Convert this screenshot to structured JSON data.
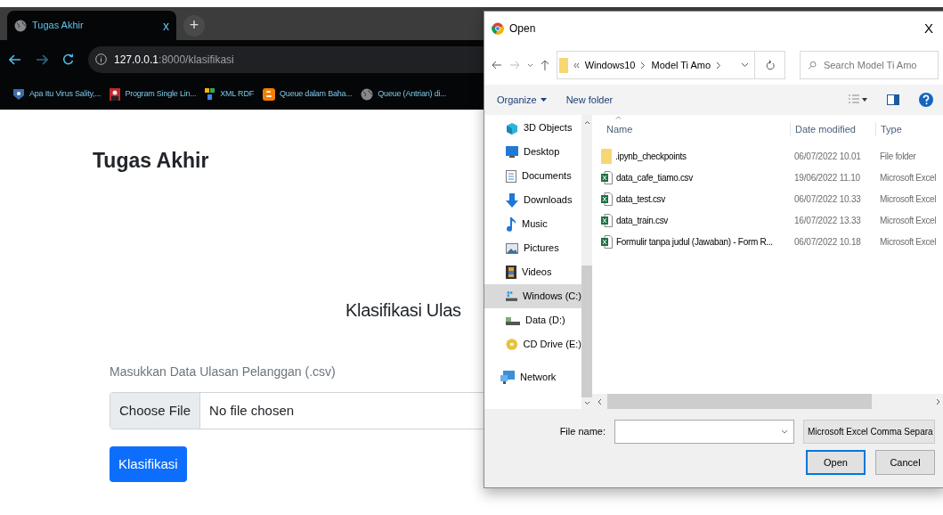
{
  "browser": {
    "tab": {
      "title": "Tugas Akhir",
      "close": "x",
      "selected": true
    },
    "new_tab": "+",
    "address": {
      "host": "127.0.0.1",
      "path": ":8000/klasifikasi"
    },
    "bookmarks": [
      {
        "label": "Apa Itu Virus Sality,...",
        "kind": "shield"
      },
      {
        "label": "Program Single Lin...",
        "kind": "photo"
      },
      {
        "label": "XML RDF",
        "kind": "squares"
      },
      {
        "label": "Queue dalam Baha...",
        "kind": "blogger"
      },
      {
        "label": "Queue (Antrian) di...",
        "kind": "globe"
      }
    ]
  },
  "page": {
    "brand": "Tugas Akhir",
    "heading": "Klasifikasi Ulas",
    "field_label": "Masukkan Data Ulasan Pelanggan (.csv)",
    "choose_button": "Choose File",
    "file_status": "No file chosen",
    "submit": "Klasifikasi"
  },
  "dialog": {
    "title": "Open",
    "close": "X",
    "breadcrumb": [
      "Windows10",
      "Model Ti Amo"
    ],
    "search": {
      "placeholder": "Search Model Ti Amo"
    },
    "toolbar": [
      "Organize",
      "New folder"
    ],
    "sidebar": [
      {
        "label": "3D Objects",
        "kind": "cube",
        "selected": false
      },
      {
        "label": "Desktop",
        "kind": "desktop",
        "selected": false
      },
      {
        "label": "Documents",
        "kind": "document",
        "selected": false
      },
      {
        "label": "Downloads",
        "kind": "download",
        "selected": false
      },
      {
        "label": "Music",
        "kind": "music",
        "selected": false
      },
      {
        "label": "Pictures",
        "kind": "pictures",
        "selected": false
      },
      {
        "label": "Videos",
        "kind": "videos",
        "selected": false
      },
      {
        "label": "Windows (C:)",
        "kind": "drive",
        "selected": true
      },
      {
        "label": "Data (D:)",
        "kind": "drive2",
        "selected": false
      },
      {
        "label": "CD Drive (E:)",
        "kind": "cd",
        "selected": false
      },
      {
        "label": "Network",
        "kind": "network",
        "selected": false
      }
    ],
    "columns": [
      "Name",
      "Date modified",
      "Type"
    ],
    "files": [
      {
        "name": ".ipynb_checkpoints",
        "date": "06/07/2022 10.01",
        "type": "File folder",
        "kind": "folder"
      },
      {
        "name": "data_cafe_tiamo.csv",
        "date": "19/06/2022 11.10",
        "type": "Microsoft Excel",
        "kind": "excel"
      },
      {
        "name": "data_test.csv",
        "date": "06/07/2022 10.33",
        "type": "Microsoft Excel",
        "kind": "excel"
      },
      {
        "name": "data_train.csv",
        "date": "16/07/2022 13.33",
        "type": "Microsoft Excel",
        "kind": "excel"
      },
      {
        "name": "Formulir tanpa judul (Jawaban) - Form R...",
        "date": "06/07/2022 10.18",
        "type": "Microsoft Excel",
        "kind": "excel"
      }
    ],
    "file_name_label": "File name:",
    "filter": "Microsoft Excel Comma Separa",
    "buttons": [
      {
        "label": "Open",
        "default": true
      },
      {
        "label": "Cancel",
        "default": false
      }
    ]
  }
}
